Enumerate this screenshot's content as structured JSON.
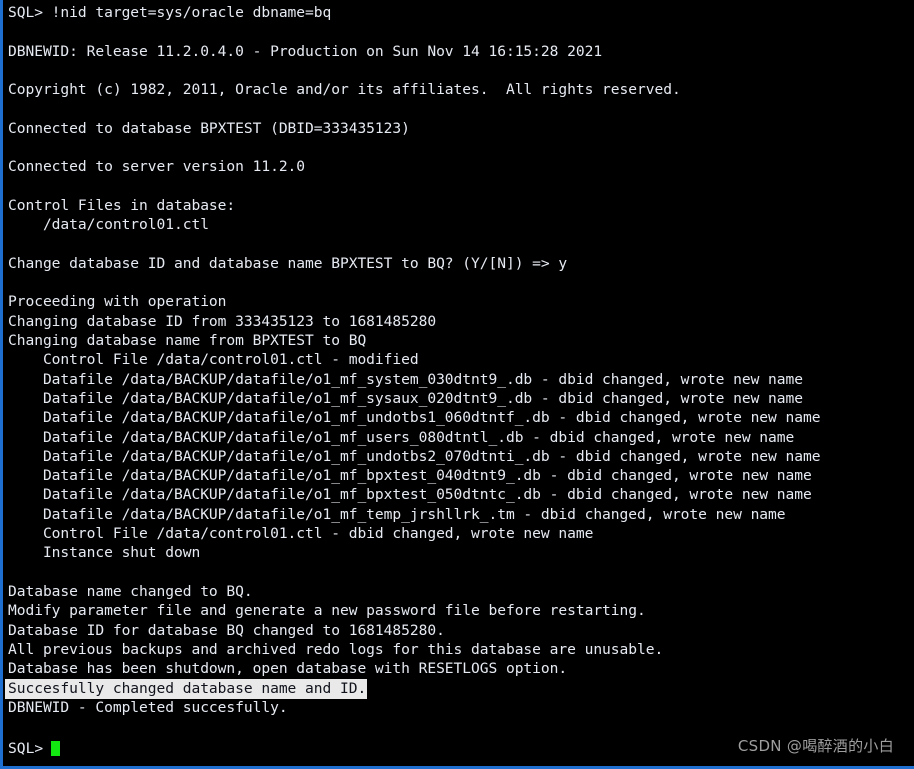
{
  "terminal": {
    "background_color": "#000000",
    "text_color": "#e6eaf2",
    "border_color": "#1f6fd0",
    "cursor_color": "#12e712",
    "highlight_bg": "#e9e9e9",
    "highlight_fg": "#10131c"
  },
  "lines": [
    {
      "text": "SQL> !nid target=sys/oracle dbname=bq",
      "style": "normal"
    },
    {
      "text": "",
      "style": "blank"
    },
    {
      "text": "DBNEWID: Release 11.2.0.4.0 - Production on Sun Nov 14 16:15:28 2021",
      "style": "normal"
    },
    {
      "text": "",
      "style": "blank"
    },
    {
      "text": "Copyright (c) 1982, 2011, Oracle and/or its affiliates.  All rights reserved.",
      "style": "normal"
    },
    {
      "text": "",
      "style": "blank"
    },
    {
      "text": "Connected to database BPXTEST (DBID=333435123)",
      "style": "normal"
    },
    {
      "text": "",
      "style": "blank"
    },
    {
      "text": "Connected to server version 11.2.0",
      "style": "normal"
    },
    {
      "text": "",
      "style": "blank"
    },
    {
      "text": "Control Files in database:",
      "style": "normal"
    },
    {
      "text": "    /data/control01.ctl",
      "style": "normal"
    },
    {
      "text": "",
      "style": "blank"
    },
    {
      "text": "Change database ID and database name BPXTEST to BQ? (Y/[N]) => y",
      "style": "normal"
    },
    {
      "text": "",
      "style": "blank"
    },
    {
      "text": "Proceeding with operation",
      "style": "normal"
    },
    {
      "text": "Changing database ID from 333435123 to 1681485280",
      "style": "normal"
    },
    {
      "text": "Changing database name from BPXTEST to BQ",
      "style": "normal"
    },
    {
      "text": "    Control File /data/control01.ctl - modified",
      "style": "normal"
    },
    {
      "text": "    Datafile /data/BACKUP/datafile/o1_mf_system_030dtnt9_.db - dbid changed, wrote new name",
      "style": "normal"
    },
    {
      "text": "    Datafile /data/BACKUP/datafile/o1_mf_sysaux_020dtnt9_.db - dbid changed, wrote new name",
      "style": "normal"
    },
    {
      "text": "    Datafile /data/BACKUP/datafile/o1_mf_undotbs1_060dtntf_.db - dbid changed, wrote new name",
      "style": "normal"
    },
    {
      "text": "    Datafile /data/BACKUP/datafile/o1_mf_users_080dtntl_.db - dbid changed, wrote new name",
      "style": "normal"
    },
    {
      "text": "    Datafile /data/BACKUP/datafile/o1_mf_undotbs2_070dtnti_.db - dbid changed, wrote new name",
      "style": "normal"
    },
    {
      "text": "    Datafile /data/BACKUP/datafile/o1_mf_bpxtest_040dtnt9_.db - dbid changed, wrote new name",
      "style": "normal"
    },
    {
      "text": "    Datafile /data/BACKUP/datafile/o1_mf_bpxtest_050dtntc_.db - dbid changed, wrote new name",
      "style": "normal"
    },
    {
      "text": "    Datafile /data/BACKUP/datafile/o1_mf_temp_jrshllrk_.tm - dbid changed, wrote new name",
      "style": "normal"
    },
    {
      "text": "    Control File /data/control01.ctl - dbid changed, wrote new name",
      "style": "normal"
    },
    {
      "text": "    Instance shut down",
      "style": "normal"
    },
    {
      "text": "",
      "style": "blank"
    },
    {
      "text": "Database name changed to BQ.",
      "style": "normal"
    },
    {
      "text": "Modify parameter file and generate a new password file before restarting.",
      "style": "normal"
    },
    {
      "text": "Database ID for database BQ changed to 1681485280.",
      "style": "normal"
    },
    {
      "text": "All previous backups and archived redo logs for this database are unusable.",
      "style": "normal"
    },
    {
      "text": "Database has been shutdown, open database with RESETLOGS option.",
      "style": "normal"
    },
    {
      "text": "Succesfully changed database name and ID.",
      "style": "highlight"
    },
    {
      "text": "DBNEWID - Completed succesfully.",
      "style": "normal"
    }
  ],
  "prompt": {
    "text": "SQL>",
    "cursor": "block-cursor"
  },
  "watermark": {
    "text": "CSDN @喝醉酒的小白"
  }
}
